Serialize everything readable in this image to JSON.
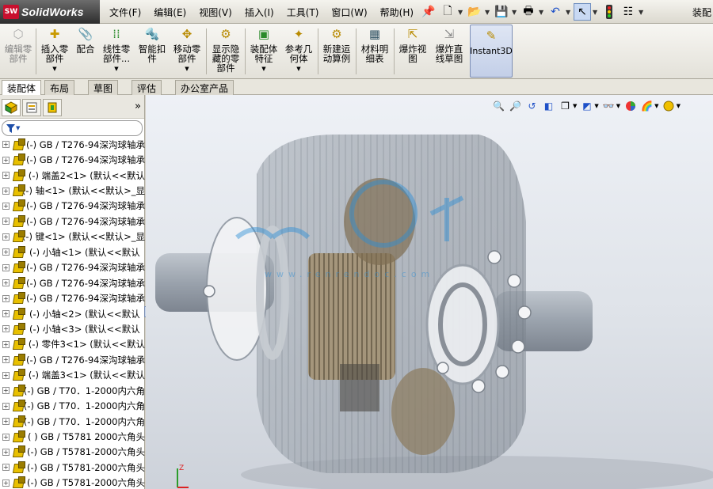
{
  "app": {
    "logo_badge": "SW",
    "name": "SolidWorks",
    "title_right": "装配"
  },
  "menus": [
    "文件(F)",
    "编辑(E)",
    "视图(V)",
    "插入(I)",
    "工具(T)",
    "窗口(W)",
    "帮助(H)"
  ],
  "quick_access": {
    "icons": [
      "pin-icon",
      "new-document-icon",
      "open-folder-icon",
      "save-icon",
      "print-icon",
      "undo-icon",
      "select-cursor-icon",
      "traffic-light-icon",
      "options-icon"
    ]
  },
  "command_manager": {
    "buttons": [
      {
        "label": "编辑零\n部件",
        "icon": "edit-component-icon",
        "enabled": false
      },
      {
        "label": "插入零\n部件",
        "icon": "insert-component-icon",
        "enabled": true,
        "dropdown": true
      },
      {
        "label": "配合",
        "icon": "mate-icon",
        "enabled": true
      },
      {
        "label": "线性零\n部件...",
        "icon": "linear-pattern-icon",
        "enabled": true,
        "dropdown": true
      },
      {
        "label": "智能扣\n件",
        "icon": "smart-fastener-icon",
        "enabled": true
      },
      {
        "label": "移动零\n部件",
        "icon": "move-component-icon",
        "enabled": true,
        "dropdown": true
      },
      {
        "label": "显示隐\n藏的零\n部件",
        "icon": "show-hidden-icon",
        "enabled": true
      },
      {
        "label": "装配体\n特征",
        "icon": "assembly-feature-icon",
        "enabled": true,
        "dropdown": true
      },
      {
        "label": "参考几\n何体",
        "icon": "reference-geometry-icon",
        "enabled": true,
        "dropdown": true
      },
      {
        "label": "新建运\n动算例",
        "icon": "new-motion-study-icon",
        "enabled": true
      },
      {
        "label": "材料明\n细表",
        "icon": "bill-of-materials-icon",
        "enabled": true
      },
      {
        "label": "爆炸视\n图",
        "icon": "exploded-view-icon",
        "enabled": true
      },
      {
        "label": "爆炸直\n线草图",
        "icon": "explode-line-sketch-icon",
        "enabled": true
      },
      {
        "label": "Instant3D",
        "icon": "instant3d-icon",
        "enabled": true,
        "active": true
      }
    ]
  },
  "cm_tabs": [
    {
      "label": "装配体",
      "active": true
    },
    {
      "label": "布局",
      "active": false
    },
    {
      "label": "草图",
      "active": false
    },
    {
      "label": "评估",
      "active": false
    },
    {
      "label": "办公室产品",
      "active": false
    }
  ],
  "panel": {
    "tabs": [
      "feature-manager-icon",
      "property-manager-icon",
      "configuration-manager-icon"
    ],
    "chevron": "»",
    "filter_glyph": "▼"
  },
  "tree_items": [
    "(-) GB / T276-94深沟球轴承",
    "(-) GB / T276-94深沟球轴承",
    "(-) 端盖2<1> (默认<<默认",
    "(-) 轴<1> (默认<<默认>_显",
    "(-) GB / T276-94深沟球轴承",
    "(-) GB / T276-94深沟球轴承",
    "(-) 键<1> (默认<<默认>_显",
    "(-) 小轴<1> (默认<<默认",
    "(-) GB / T276-94深沟球轴承",
    "(-) GB / T276-94深沟球轴承",
    "(-) GB / T276-94深沟球轴承",
    "(-) 小轴<2> (默认<<默认",
    "(-) 小轴<3> (默认<<默认",
    "(-) 零件3<1> (默认<<默认",
    "(-) GB / T276-94深沟球轴承",
    "(-) 端盖3<1> (默认<<默认",
    "(-) GB / T70．1-2000内六角",
    "(-) GB / T70．1-2000内六角",
    "(-) GB / T70．1-2000内六角",
    "( ) GB / T5781 2000六角头",
    "(-) GB / T5781-2000六角头",
    "(-) GB / T5781-2000六角头",
    "(-) GB / T5781-2000六角头"
  ],
  "view_tools": [
    "zoom-to-fit-icon",
    "zoom-area-icon",
    "previous-view-icon",
    "section-view-icon",
    "view-orientation-icon",
    "display-style-icon",
    "hide-show-icon",
    "edit-appearance-icon",
    "apply-scene-icon",
    "view-settings-icon"
  ],
  "viewport": {
    "watermark_text": "www.renrendoc.com",
    "triad_label": "Z",
    "colors": {
      "background_top": "#eef1f6",
      "background_bottom": "#cdd2da",
      "part_gray": "#8a94a0",
      "gear_tan": "#a39274"
    }
  }
}
